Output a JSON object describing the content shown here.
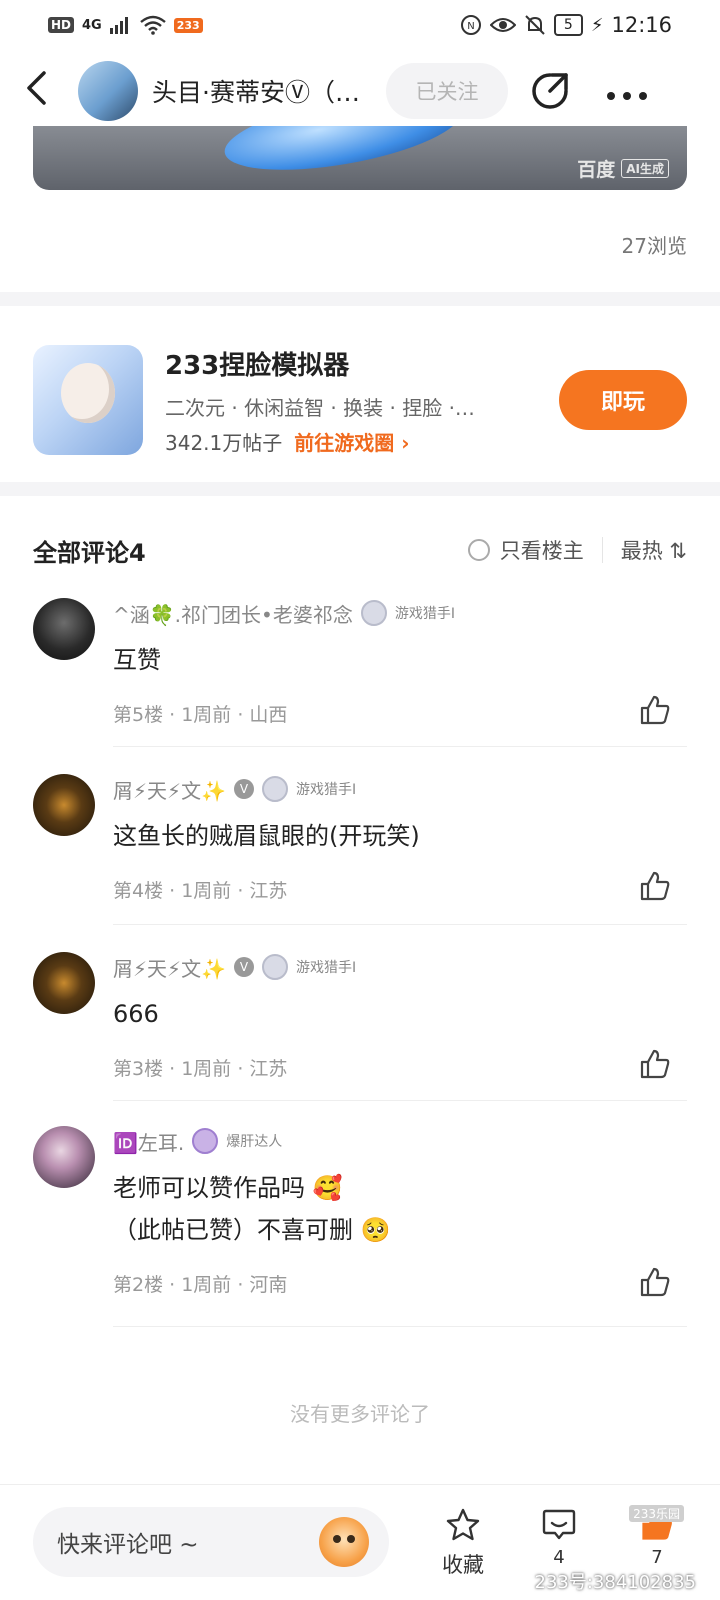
{
  "status_bar": {
    "hd": "HD",
    "network": "4G",
    "app_tag": "233",
    "battery": "5",
    "time": "12:16"
  },
  "header": {
    "back_icon": "back-arrow-icon",
    "author_name": "头目·赛蒂安Ⓥ（…",
    "follow_label": "已关注",
    "share_icon": "share-icon",
    "more_icon": "more-icon"
  },
  "banner": {
    "watermark_brand": "百度",
    "watermark_tag": "AI生成"
  },
  "post": {
    "views": "27浏览"
  },
  "game": {
    "name": "233捏脸模拟器",
    "tags": "二次元 · 休闲益智 · 换装 · 捏脸 ·…",
    "posts_count": "342.1万帖子",
    "link_label": "前往游戏圈 ›",
    "play_label": "即玩"
  },
  "comments_header": {
    "title": "全部评论4",
    "only_host_label": "只看楼主",
    "sort_label": "最热 ⇅"
  },
  "comments": [
    {
      "name": "^涵🍀.祁门团长•老婆祁念",
      "rank": "游戏猎手Ⅰ",
      "text": "互赞",
      "meta": "第5楼 · 1周前 · 山西"
    },
    {
      "name": "屑⚡天⚡文✨",
      "rank": "游戏猎手Ⅰ",
      "text": "这鱼长的贼眉鼠眼的(开玩笑)",
      "meta": "第4楼 · 1周前 · 江苏"
    },
    {
      "name": "屑⚡天⚡文✨",
      "rank": "游戏猎手Ⅰ",
      "text": "666",
      "meta": "第3楼 · 1周前 · 江苏"
    },
    {
      "name": "🆔左耳.",
      "rank": "爆肝达人",
      "text_line1": "老师可以赞作品吗 🥰",
      "text_line2": "（此帖已赞）不喜可删 🥺",
      "meta": "第2楼 · 1周前 · 河南"
    }
  ],
  "no_more": "没有更多评论了",
  "bottom_bar": {
    "input_placeholder": "快来评论吧 ~",
    "favorite_label": "收藏",
    "comment_count": "4",
    "like_count": "7",
    "watermark": "233号:384102835",
    "watermark_logo": "233乐园"
  },
  "colors": {
    "accent": "#f57520",
    "link": "#f06a1e",
    "text_primary": "#222222",
    "text_secondary": "#888888"
  }
}
